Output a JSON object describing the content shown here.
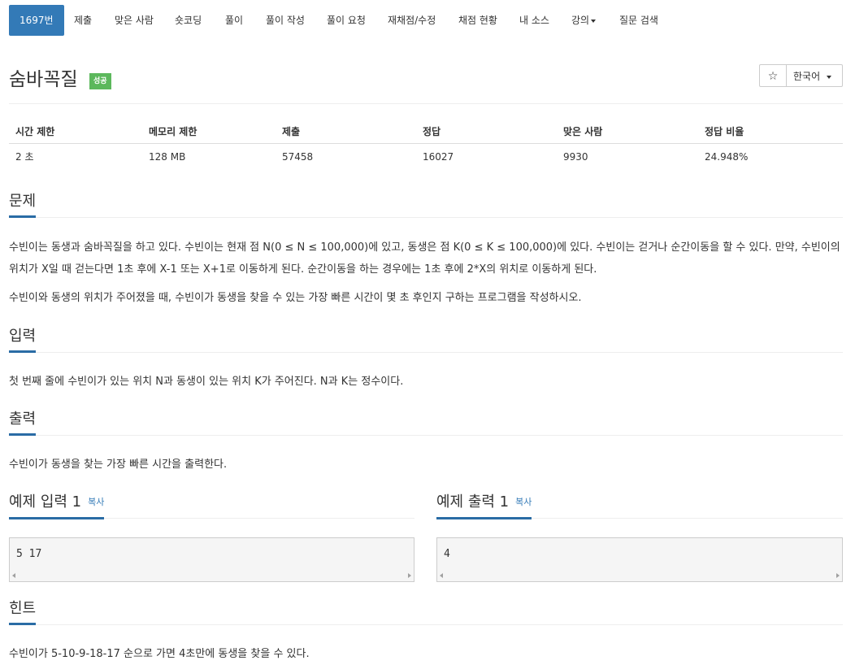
{
  "nav": {
    "items": [
      "1697번",
      "제출",
      "맞은 사람",
      "숏코딩",
      "풀이",
      "풀이 작성",
      "풀이 요청",
      "재채점/수정",
      "채점 현황",
      "내 소스",
      "강의",
      "질문 검색"
    ]
  },
  "problem": {
    "title": "숨바꼭질",
    "status": "성공",
    "star": "☆",
    "language": "한국어"
  },
  "info_table": {
    "headers": [
      "시간 제한",
      "메모리 제한",
      "제출",
      "정답",
      "맞은 사람",
      "정답 비율"
    ],
    "values": [
      "2 초",
      "128 MB",
      "57458",
      "16027",
      "9930",
      "24.948%"
    ]
  },
  "sections": {
    "problem_heading": "문제",
    "problem_p1": "수빈이는 동생과 숨바꼭질을 하고 있다. 수빈이는 현재 점 N(0 ≤ N ≤ 100,000)에 있고, 동생은 점 K(0 ≤ K ≤ 100,000)에 있다. 수빈이는 걷거나 순간이동을 할 수 있다. 만약, 수빈이의 위치가 X일 때 걷는다면 1초 후에 X-1 또는 X+1로 이동하게 된다. 순간이동을 하는 경우에는 1초 후에 2*X의 위치로 이동하게 된다.",
    "problem_p2": "수빈이와 동생의 위치가 주어졌을 때, 수빈이가 동생을 찾을 수 있는 가장 빠른 시간이 몇 초 후인지 구하는 프로그램을 작성하시오.",
    "input_heading": "입력",
    "input_text": "첫 번째 줄에 수빈이가 있는 위치 N과 동생이 있는 위치 K가 주어진다. N과 K는 정수이다.",
    "output_heading": "출력",
    "output_text": "수빈이가 동생을 찾는 가장 빠른 시간을 출력한다.",
    "sample_input_heading": "예제 입력 1",
    "sample_output_heading": "예제 출력 1",
    "copy_label": "복사",
    "sample_input": "5 17",
    "sample_output": "4",
    "hint_heading": "힌트",
    "hint_text": "수빈이가 5-10-9-18-17 순으로 가면 4초만에 동생을 찾을 수 있다."
  }
}
